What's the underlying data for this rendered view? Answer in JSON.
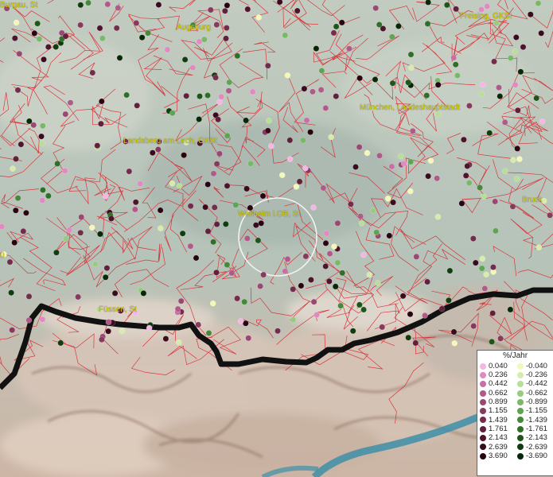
{
  "map": {
    "places": [
      {
        "key": "burgau",
        "label": "Burgau, St"
      },
      {
        "key": "augsburg",
        "label": "Augsburg"
      },
      {
        "key": "freising",
        "label": "Freising, GKSt"
      },
      {
        "key": "muenchen",
        "label": "München, Landeshauptstadt"
      },
      {
        "key": "landsberg",
        "label": "Landsberg am Lech, GKSt"
      },
      {
        "key": "weilheim",
        "label": "Weilheim i.OB, St"
      },
      {
        "key": "bruck",
        "label": "Bruck"
      },
      {
        "key": "fuessen",
        "label": "Füssen, St"
      },
      {
        "key": "left_edge",
        "label": "ü"
      }
    ]
  },
  "legend": {
    "title": "%/Jahr",
    "positive": [
      {
        "value": "0.040",
        "color": "#f4b7e3"
      },
      {
        "value": "0.236",
        "color": "#e08ac2"
      },
      {
        "value": "0.442",
        "color": "#c96ea6"
      },
      {
        "value": "0.662",
        "color": "#b05a8a"
      },
      {
        "value": "0.899",
        "color": "#9a4872"
      },
      {
        "value": "1.155",
        "color": "#873a5e"
      },
      {
        "value": "1.439",
        "color": "#742c4c"
      },
      {
        "value": "1.761",
        "color": "#61203b"
      },
      {
        "value": "2.143",
        "color": "#4d142b"
      },
      {
        "value": "2.639",
        "color": "#3a0a1e"
      },
      {
        "value": "3.690",
        "color": "#280412"
      }
    ],
    "negative": [
      {
        "value": "-0.040",
        "color": "#f3f7b8"
      },
      {
        "value": "-0.236",
        "color": "#d6ecaa"
      },
      {
        "value": "-0.442",
        "color": "#b8de98"
      },
      {
        "value": "-0.662",
        "color": "#97cc80"
      },
      {
        "value": "-0.899",
        "color": "#78b968"
      },
      {
        "value": "-1.155",
        "color": "#5ea452"
      },
      {
        "value": "-1.439",
        "color": "#448a3a"
      },
      {
        "value": "-1.761",
        "color": "#2f7028"
      },
      {
        "value": "-2.143",
        "color": "#1e561a"
      },
      {
        "value": "-2.639",
        "color": "#103d0e"
      },
      {
        "value": "-3.690",
        "color": "#062806"
      }
    ]
  }
}
